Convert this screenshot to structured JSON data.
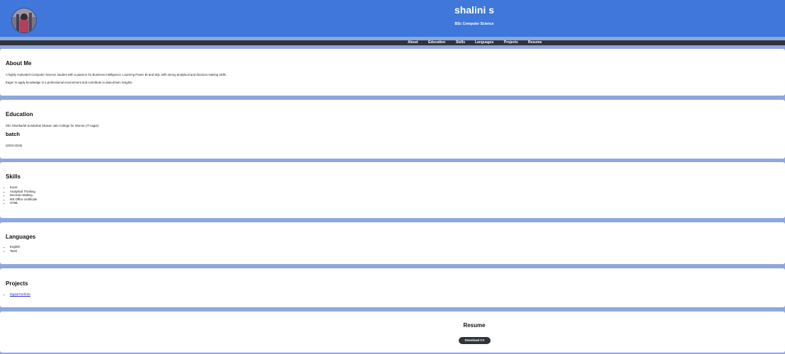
{
  "header": {
    "name": "shalini s",
    "subtitle": "BSc Computer Science",
    "avatar_icon": "profile-photo"
  },
  "nav": {
    "items": [
      "About",
      "Education",
      "Skills",
      "Languages",
      "Projects",
      "Resume"
    ]
  },
  "about": {
    "title": "About Me",
    "line1": "A highly motivated Computer Science student with a passion for Business Intelligence. Learning Power BI and SQL with strong analytical and decision-making skills.",
    "line2": "Eager to apply knowledge in a professional environment and contribute to data-driven insights."
  },
  "education": {
    "title": "Education",
    "college": "Shri Shankarlal Sundarbai Shasun Jain College for Women (T-nagar)",
    "batch_label": "batch",
    "batch_years": "(2023-2026)"
  },
  "skills": {
    "title": "Skills",
    "items": [
      "Excel",
      "Analytical Thinking",
      "Decision-Making",
      "MS Office certificate",
      "HTML"
    ]
  },
  "languages": {
    "title": "Languages",
    "items": [
      "English",
      "Tamil"
    ]
  },
  "projects": {
    "title": "Projects",
    "items": [
      "Digital Portfolio"
    ]
  },
  "resume": {
    "title": "Resume",
    "button_label": "Download CV"
  },
  "colors": {
    "header_bg": "#3f78da",
    "nav_bg": "#2f343a",
    "page_bg": "#8fa7df",
    "card_bg": "#ffffff",
    "link": "#2a2acc"
  }
}
